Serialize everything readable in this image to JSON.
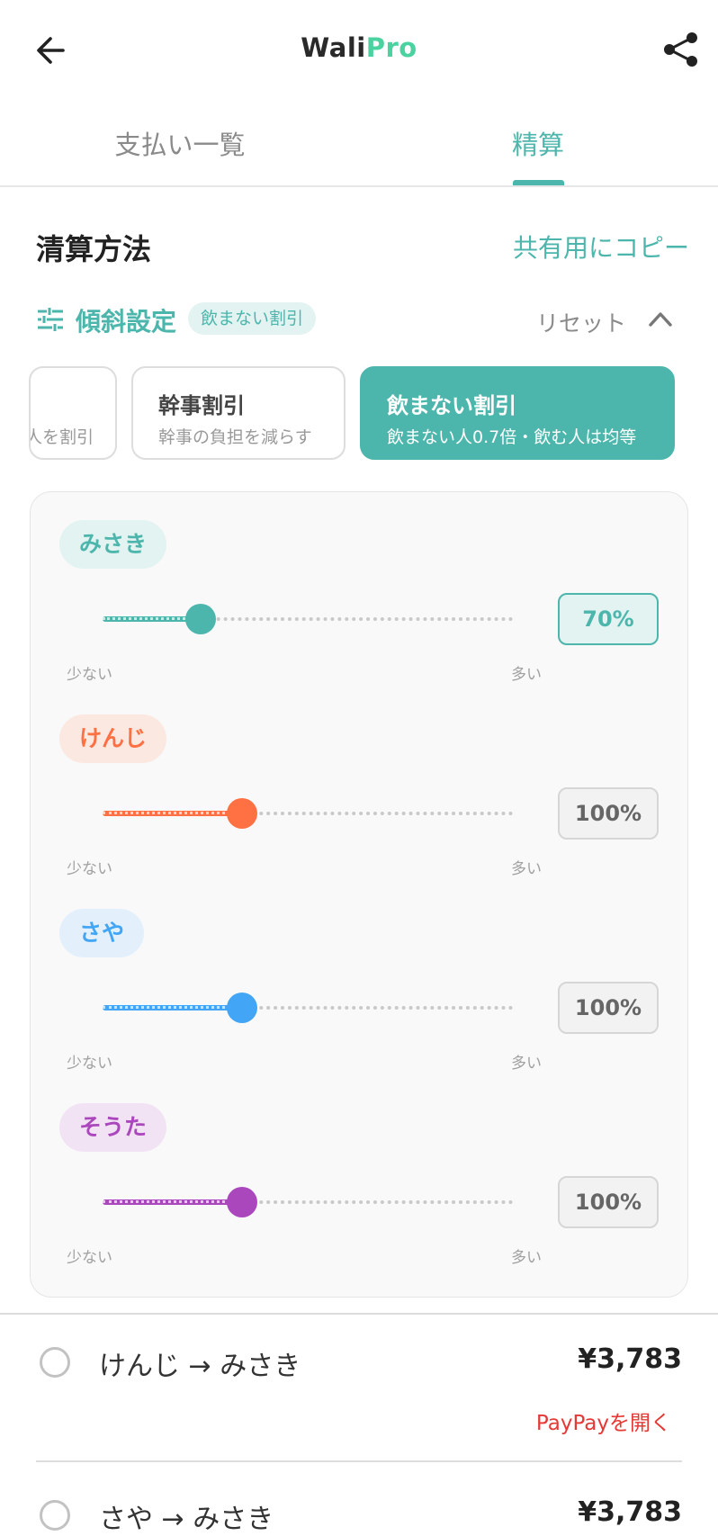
{
  "header": {
    "logo_main": "Wali",
    "logo_accent": "Pro",
    "back_icon": "arrow-left-icon",
    "share_icon": "share-icon"
  },
  "tabs": [
    {
      "label": "支払い一覧",
      "active": false
    },
    {
      "label": "精算",
      "active": true
    }
  ],
  "section": {
    "title": "清算方法",
    "copy_label": "共有用にコピー"
  },
  "tilt": {
    "title": "傾斜設定",
    "badge": "飲まない割引",
    "reset_label": "リセット",
    "icon": "tune-icon"
  },
  "presets": [
    {
      "title": "",
      "desc": "人を割引",
      "partial": true
    },
    {
      "title": "幹事割引",
      "desc": "幹事の負担を減らす"
    },
    {
      "title": "飲まない割引",
      "desc": "飲まない人0.7倍・飲む人は均等",
      "selected": true
    }
  ],
  "members": [
    {
      "name": "みさき",
      "percent": "70%",
      "level": 0.24,
      "color": "#4db6ac",
      "chip_bg": "#e2f3f1",
      "min_label": "少ない",
      "max_label": "多い"
    },
    {
      "name": "けんじ",
      "percent": "100%",
      "level": 0.34,
      "color": "#ff7043",
      "chip_bg": "#fbe8e1",
      "min_label": "少ない",
      "max_label": "多い"
    },
    {
      "name": "さや",
      "percent": "100%",
      "level": 0.34,
      "color": "#42a5f5",
      "chip_bg": "#e3f0fb",
      "min_label": "少ない",
      "max_label": "多い"
    },
    {
      "name": "そうた",
      "percent": "100%",
      "level": 0.34,
      "color": "#ab47bc",
      "chip_bg": "#f2e3f4",
      "min_label": "少ない",
      "max_label": "多い"
    }
  ],
  "transfers": [
    {
      "from": "けんじ",
      "to": "みさき",
      "names": "けんじ → みさき",
      "amount": "¥3,783",
      "link": "PayPayを開く"
    },
    {
      "from": "さや",
      "to": "みさき",
      "names": "さや → みさき",
      "amount": "¥3,783"
    }
  ]
}
